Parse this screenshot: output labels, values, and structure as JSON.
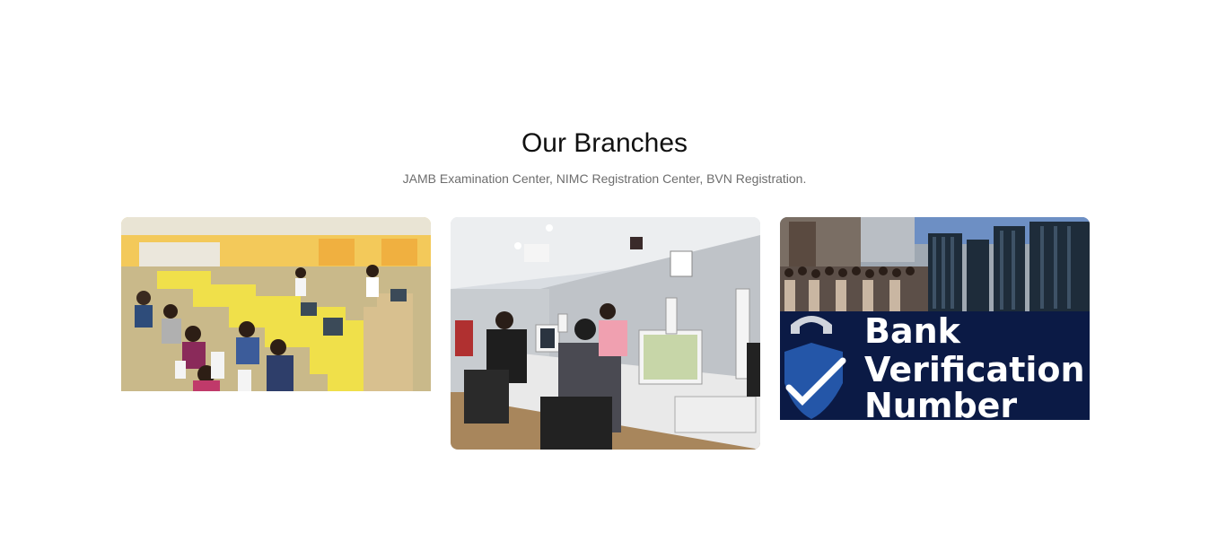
{
  "branches": {
    "title": "Our Branches",
    "subtitle": "JAMB Examination Center, NIMC Registration Center, BVN Registration."
  },
  "images": [
    {
      "name": "jamb-examination-center-photo"
    },
    {
      "name": "nimc-registration-center-photo"
    },
    {
      "name": "bvn-registration-banner",
      "banner_lines": [
        "Bank",
        "Verification",
        "Number"
      ]
    }
  ]
}
